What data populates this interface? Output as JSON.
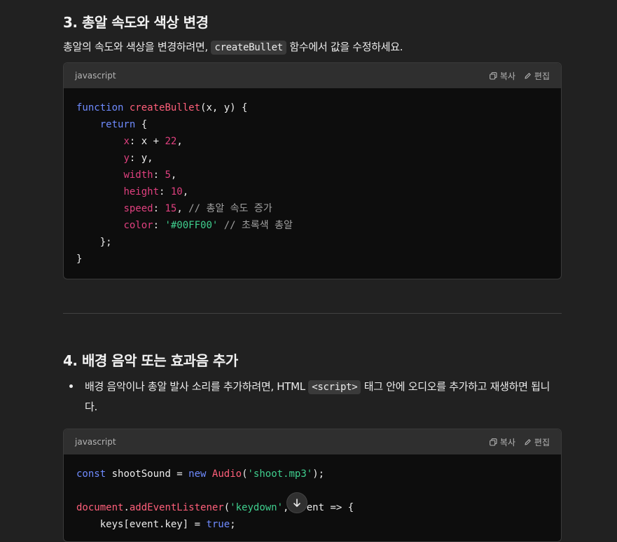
{
  "section3": {
    "heading": "3. 총알 속도와 색상 변경",
    "para_before": "총알의 속도와 색상을 변경하려면, ",
    "para_code": "createBullet",
    "para_after": " 함수에서 값을 수정하세요."
  },
  "codeblock1": {
    "language": "javascript",
    "copy_label": "복사",
    "edit_label": "편집"
  },
  "section4": {
    "heading": "4. 배경 음악 또는 효과음 추가",
    "bullet_before": "배경 음악이나 총알 발사 소리를 추가하려면, HTML ",
    "bullet_code": "<script>",
    "bullet_after": " 태그 안에 오디오를 추가하고 재생하면 됩니다."
  },
  "codeblock2": {
    "language": "javascript",
    "copy_label": "복사",
    "edit_label": "편집"
  },
  "icons": {
    "copy": "copy-icon",
    "edit": "edit-icon",
    "scroll": "arrow-down-icon"
  },
  "colors": {
    "background": "#212121",
    "code_bg": "#0d0d0d",
    "keyword": "#6f8bff",
    "function": "#ff5f7a",
    "property": "#e0407f",
    "string": "#3fcf8e",
    "comment": "#a0a0a0"
  }
}
